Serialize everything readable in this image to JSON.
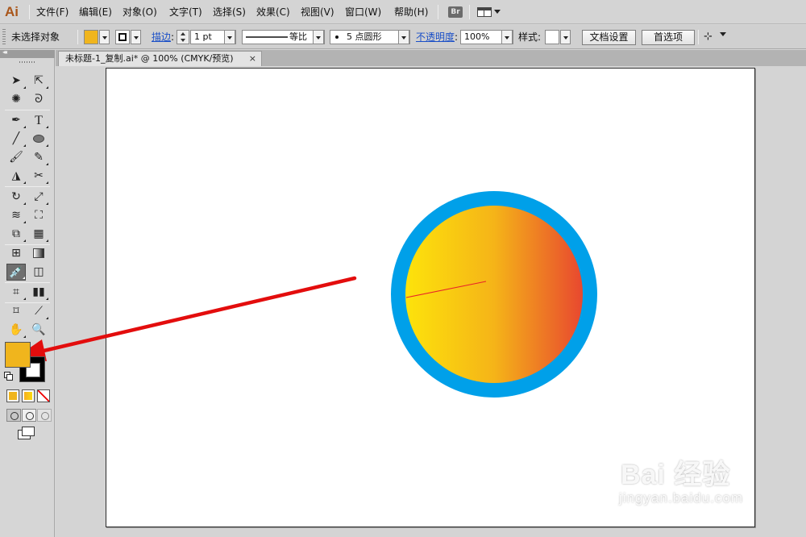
{
  "app": {
    "logo": "Ai"
  },
  "menu": {
    "items": [
      "文件(F)",
      "编辑(E)",
      "对象(O)",
      "文字(T)",
      "选择(S)",
      "效果(C)",
      "视图(V)",
      "窗口(W)",
      "帮助(H)"
    ],
    "bridge_label": "Br",
    "workspace_icon": "workspace-layout-icon"
  },
  "control_bar": {
    "selection_status": "未选择对象",
    "fill_color": "#f0b51d",
    "stroke_label": "描边",
    "stroke_weight": "1 pt",
    "stroke_profile": "等比",
    "brush_label": "5 点圆形",
    "opacity_label": "不透明度",
    "opacity_value": "100%",
    "style_label": "样式",
    "doc_setup_button": "文档设置",
    "preferences_button": "首选项"
  },
  "document": {
    "tab_title": "未标题-1_复制.ai* @ 100% (CMYK/预览)",
    "tab_close": "×"
  },
  "artwork": {
    "circle_ring_color": "#00a0e9",
    "gradient_start": "#fde30b",
    "gradient_mid": "#f5b418",
    "gradient_end": "#e8482f",
    "gradient_line_color": "#e8232a"
  },
  "annotation": {
    "arrow_color": "#e30d0d"
  },
  "tools": {
    "fill_color": "#f0b51d",
    "stroke_color": "#000000",
    "icons": [
      "selection",
      "direct-selection",
      "magic-wand",
      "lasso",
      "pen",
      "type",
      "line-segment",
      "ellipse",
      "paintbrush",
      "pencil",
      "blob-brush",
      "scissors",
      "rotate",
      "scale",
      "width",
      "free-transform",
      "shape-builder",
      "perspective-grid",
      "mesh",
      "gradient",
      "eyedropper",
      "blend",
      "symbol-sprayer",
      "column-graph",
      "artboard",
      "slice",
      "hand",
      "zoom"
    ]
  },
  "watermark": {
    "brand": "Bai 经验",
    "url": "jingyan.baidu.com"
  }
}
